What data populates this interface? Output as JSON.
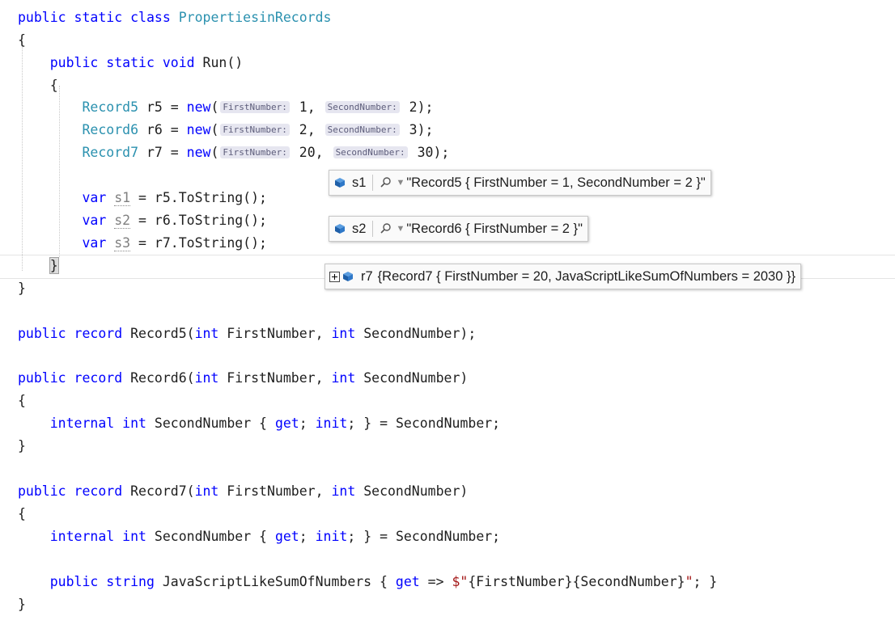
{
  "code": {
    "l1": {
      "public": "public",
      "static": "static",
      "class": "class",
      "name": "PropertiesinRecords"
    },
    "l2": "{",
    "l3": {
      "public": "public",
      "static": "static",
      "void": "void",
      "rest": "Run()"
    },
    "l4": "{",
    "l5": {
      "type": "Record5",
      "mid": " r5 = ",
      "new": "new",
      "open": "(",
      "hint1": "FirstNumber:",
      "v1": " 1,",
      "hint2": "SecondNumber:",
      "v2": " 2);"
    },
    "l6": {
      "type": "Record6",
      "mid": " r6 = ",
      "new": "new",
      "open": "(",
      "hint1": "FirstNumber:",
      "v1": " 2,",
      "hint2": "SecondNumber:",
      "v2": " 3);"
    },
    "l7": {
      "type": "Record7",
      "mid": " r7 = ",
      "new": "new",
      "open": "(",
      "hint1": "FirstNumber:",
      "v1": " 20,",
      "hint2": "SecondNumber:",
      "v2": " 30);"
    },
    "l8": {
      "var": "var",
      "name": "s1",
      "rest": " = r5.ToString();"
    },
    "l9": {
      "var": "var",
      "name": "s2",
      "rest": " = r6.ToString();"
    },
    "l10": {
      "var": "var",
      "name": "s3",
      "rest": " = r7.ToString();"
    },
    "l11": "}",
    "l12": "}",
    "l13": {
      "public": "public",
      "record": "record",
      "a": " Record5(",
      "int1": "int",
      "b": " FirstNumber, ",
      "int2": "int",
      "c": " SecondNumber);"
    },
    "l14": {
      "public": "public",
      "record": "record",
      "a": " Record6(",
      "int1": "int",
      "b": " FirstNumber, ",
      "int2": "int",
      "c": " SecondNumber)"
    },
    "l15": "{",
    "l16": {
      "internal": "internal",
      "int": "int",
      "a": " SecondNumber { ",
      "get": "get",
      "semi": "; ",
      "init": "init",
      "b": "; } = SecondNumber;"
    },
    "l17": "}",
    "l18": {
      "public": "public",
      "record": "record",
      "a": " Record7(",
      "int1": "int",
      "b": " FirstNumber, ",
      "int2": "int",
      "c": " SecondNumber)"
    },
    "l19": "{",
    "l20": {
      "internal": "internal",
      "int": "int",
      "a": " SecondNumber { ",
      "get": "get",
      "semi": "; ",
      "init": "init",
      "b": "; } = SecondNumber;"
    },
    "l21": {
      "public": "public",
      "string": "string",
      "a": " JavaScriptLikeSumOfNumbers { ",
      "get": "get",
      "arrow": " => ",
      "dollar": "$",
      "str1": "\"",
      "interp": "{FirstNumber}{SecondNumber}",
      "str2": "\"",
      "b": "; }"
    },
    "l22": "}"
  },
  "datatips": {
    "s1": {
      "name": "s1",
      "value": "\"Record5 { FirstNumber = 1, SecondNumber = 2 }\""
    },
    "s2": {
      "name": "s2",
      "value": "\"Record6 { FirstNumber = 2 }\""
    },
    "r7": {
      "name": "r7",
      "value": "{Record7 { FirstNumber = 20, JavaScriptLikeSumOfNumbers = 2030 }}"
    }
  }
}
